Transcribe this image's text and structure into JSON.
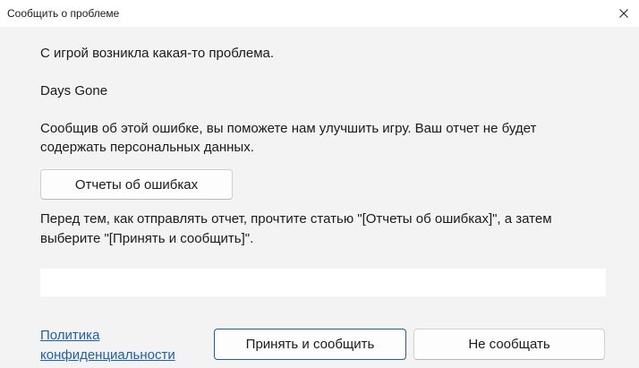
{
  "window": {
    "title": "Сообщить о проблеме"
  },
  "content": {
    "line1": "С игрой возникла какая-то проблема.",
    "game_name": "Days Gone",
    "info_line1": "Сообщив об этой ошибке, вы поможете нам улучшить игру. Ваш отчет не будет",
    "info_line2": "содержать персональных данных.",
    "reports_button": "Отчеты об ошибках",
    "instruction_line1": "Перед тем, как отправлять отчет, прочтите статью \"[Отчеты об ошибках]\", а затем",
    "instruction_line2": "выберите \"[Принять и сообщить]\"."
  },
  "footer": {
    "privacy_line1": "Политика",
    "privacy_line2": "конфиденциальности",
    "accept_button": "Принять и сообщить",
    "decline_button": "Не сообщать"
  },
  "icons": {
    "close": "close-icon"
  },
  "colors": {
    "link": "#1a5fb4",
    "primary_border": "#1b5fa8",
    "background": "#f3f3f3"
  }
}
